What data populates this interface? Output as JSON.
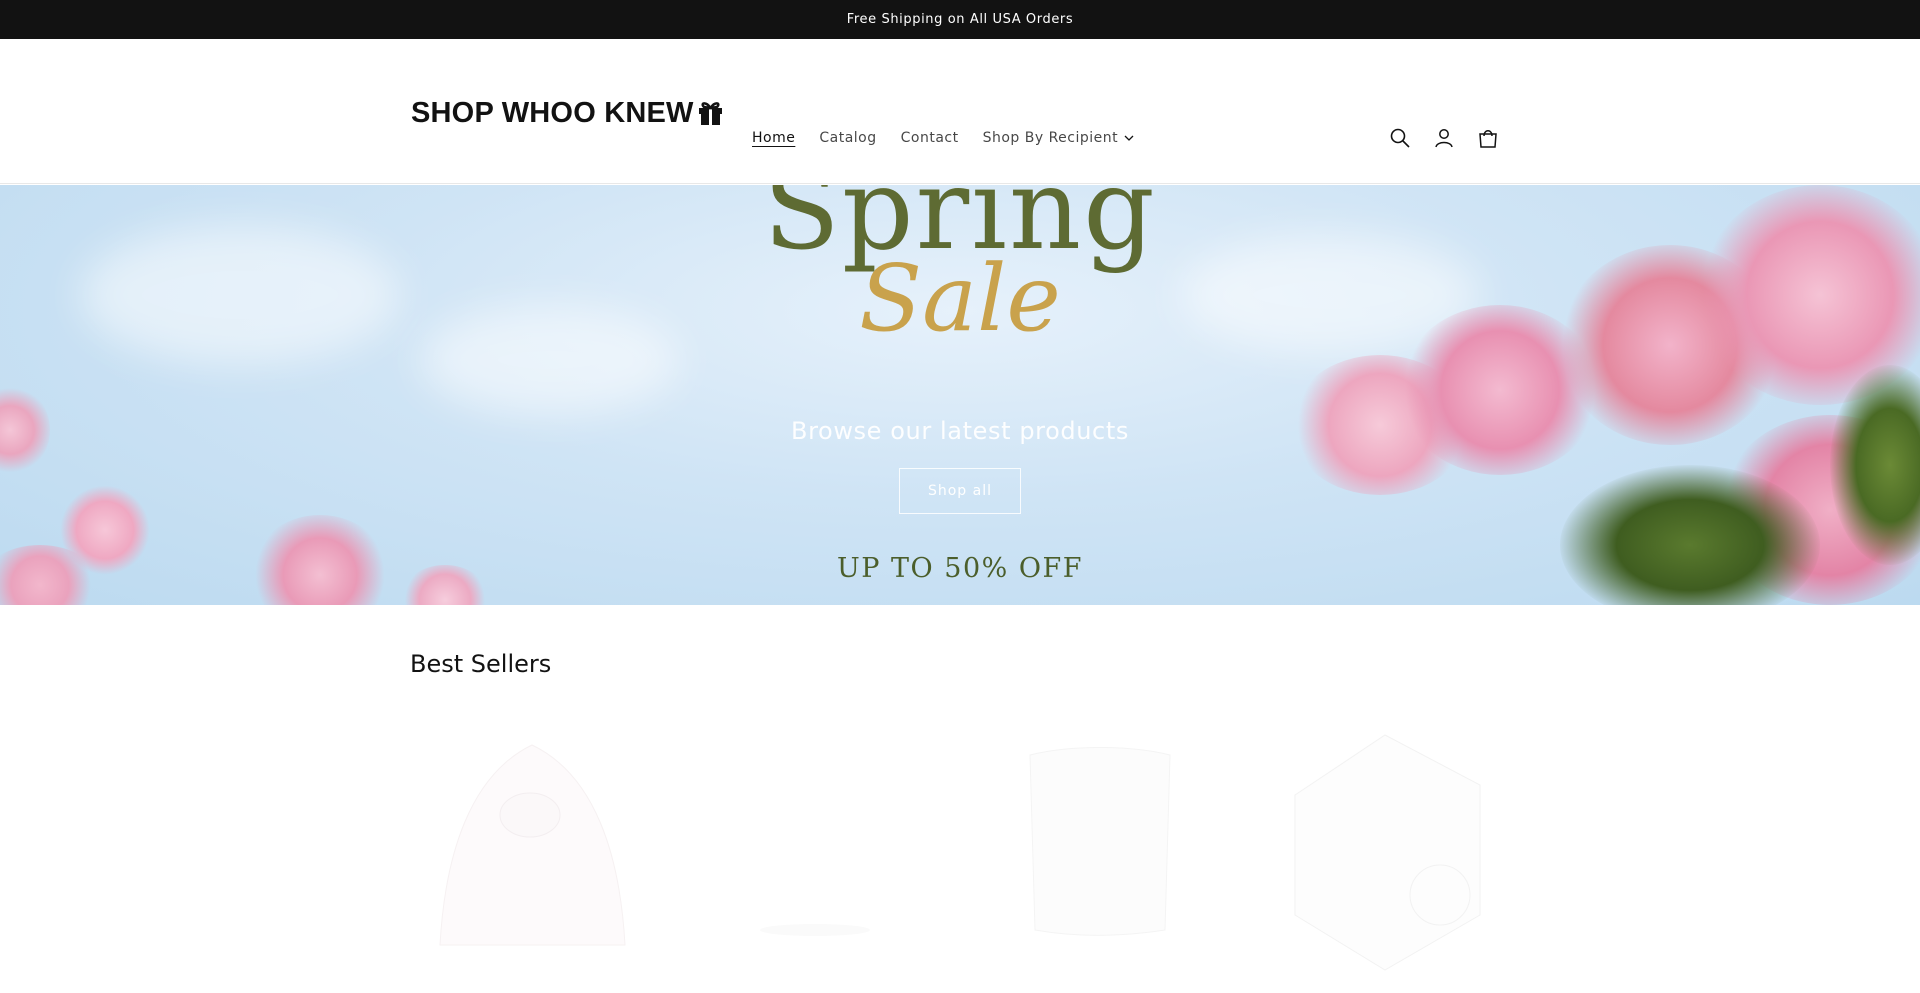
{
  "announcement": {
    "text": "Free Shipping on All USA Orders"
  },
  "header": {
    "logo_text": "SHOP WHOO KNEW",
    "nav": [
      {
        "label": "Home",
        "active": true
      },
      {
        "label": "Catalog",
        "active": false
      },
      {
        "label": "Contact",
        "active": false
      },
      {
        "label": "Shop By Recipient",
        "active": false,
        "dropdown": true
      }
    ],
    "icons": [
      "search-icon",
      "account-icon",
      "cart-icon"
    ]
  },
  "hero": {
    "title": "Spring",
    "script": "Sale",
    "subheading": "Browse our latest products",
    "button_label": "Shop all",
    "promo": "UP TO 50% OFF"
  },
  "best_sellers": {
    "heading": "Best Sellers",
    "products": [
      "product-1",
      "product-2",
      "product-3",
      "product-4"
    ]
  },
  "colors": {
    "announcement_bg": "#121212",
    "spring_text": "#5e6b33",
    "sale_text": "#c9a24c",
    "promo_text": "#4b5e2b"
  }
}
